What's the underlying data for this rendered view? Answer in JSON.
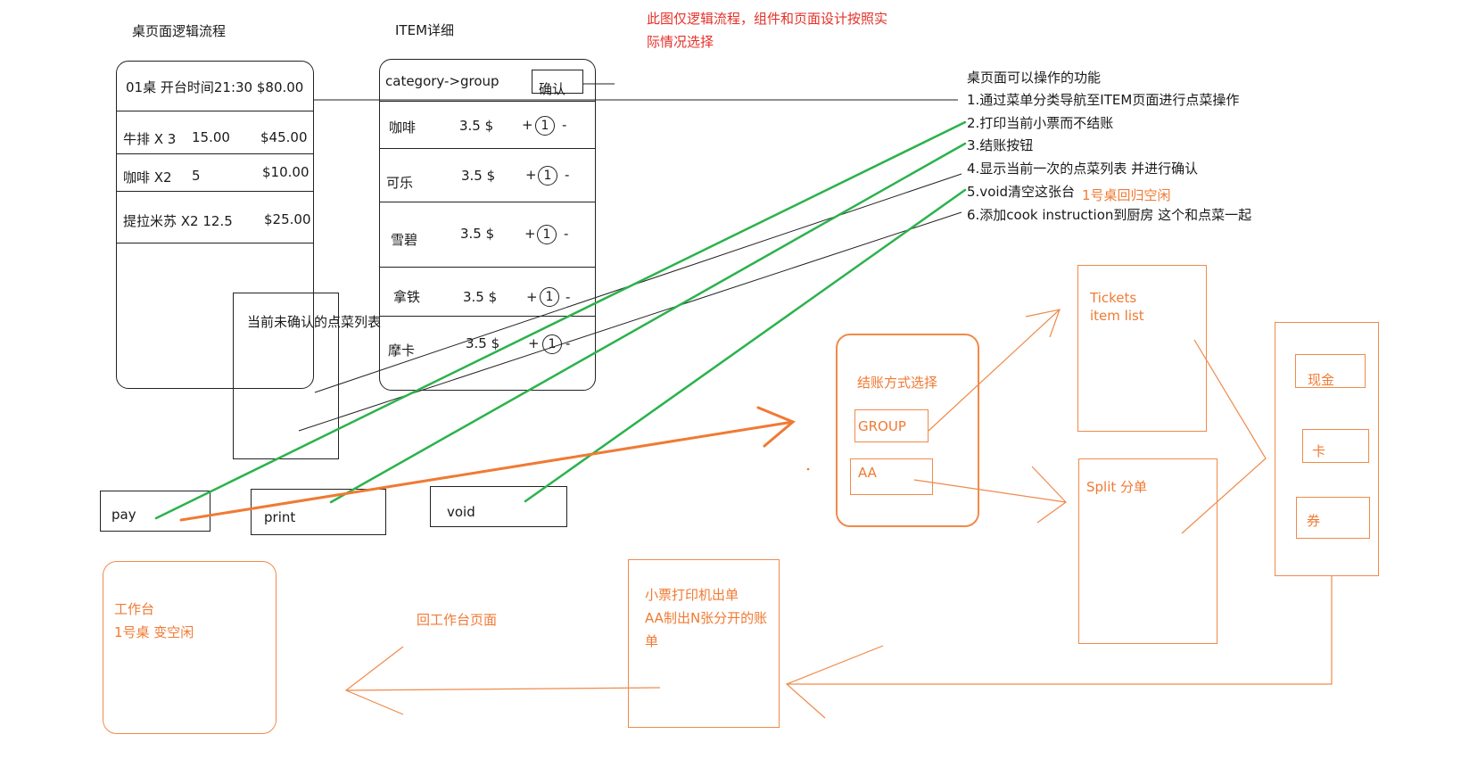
{
  "titles": {
    "table_flow": "桌页面逻辑流程",
    "item_detail": "ITEM详细",
    "note_line1": "此图仅逻辑流程，组件和页面设计按照实",
    "note_line2": "际情况选择"
  },
  "table_panel": {
    "header": "01桌  开台时间21:30   $80.00",
    "rows": [
      {
        "name": "牛排 X 3",
        "price": "15.00",
        "total": "$45.00"
      },
      {
        "name": "咖啡 X2",
        "price": "5",
        "total": "$10.00"
      },
      {
        "name": "提拉米苏 X2 12.5",
        "price": "",
        "total": "$25.00"
      }
    ]
  },
  "unconfirmed_label": "当前未确认的点菜列表",
  "item_panel": {
    "nav": "category->group",
    "confirm": "确认",
    "items": [
      {
        "name": "咖啡",
        "price": "3.5 $",
        "qty": "1"
      },
      {
        "name": "可乐",
        "price": "3.5 $",
        "qty": "1"
      },
      {
        "name": "雪碧",
        "price": "3.5 $",
        "qty": "1"
      },
      {
        "name": "拿铁",
        "price": "3.5 $",
        "qty": "1"
      },
      {
        "name": "摩卡",
        "price": "3.5 $",
        "qty": "1"
      }
    ],
    "plus": "+",
    "minus": "-"
  },
  "buttons": {
    "pay": "pay",
    "print": "print",
    "void": "void"
  },
  "functions": {
    "title": "桌页面可以操作的功能",
    "items": [
      "1.通过菜单分类导航至ITEM页面进行点菜操作",
      "2.打印当前小票而不结账",
      "3.结账按钮",
      "4.显示当前一次的点菜列表 并进行确认",
      "5.void清空这张台",
      "6.添加cook instruction到厨房 这个和点菜一起"
    ],
    "void_note": "1号桌回归空闲"
  },
  "payment_select": {
    "title": "结账方式选择",
    "group": "GROUP",
    "aa": "AA"
  },
  "tickets": {
    "line1": "Tickets",
    "line2": "item list"
  },
  "split": "Split 分单",
  "methods": {
    "cash": "现金",
    "card": "卡",
    "coupon": "券"
  },
  "printer": {
    "line1": "小票打印机出单",
    "line2": "AA制出N张分开的账",
    "line3": "单"
  },
  "back_label": "回工作台页面",
  "workbench": {
    "line1": "工作台",
    "line2": "1号桌 变空闲"
  },
  "colors": {
    "orange": "#f07a33",
    "green": "#2bb24c",
    "red": "#e5302a",
    "ink": "#222222"
  }
}
